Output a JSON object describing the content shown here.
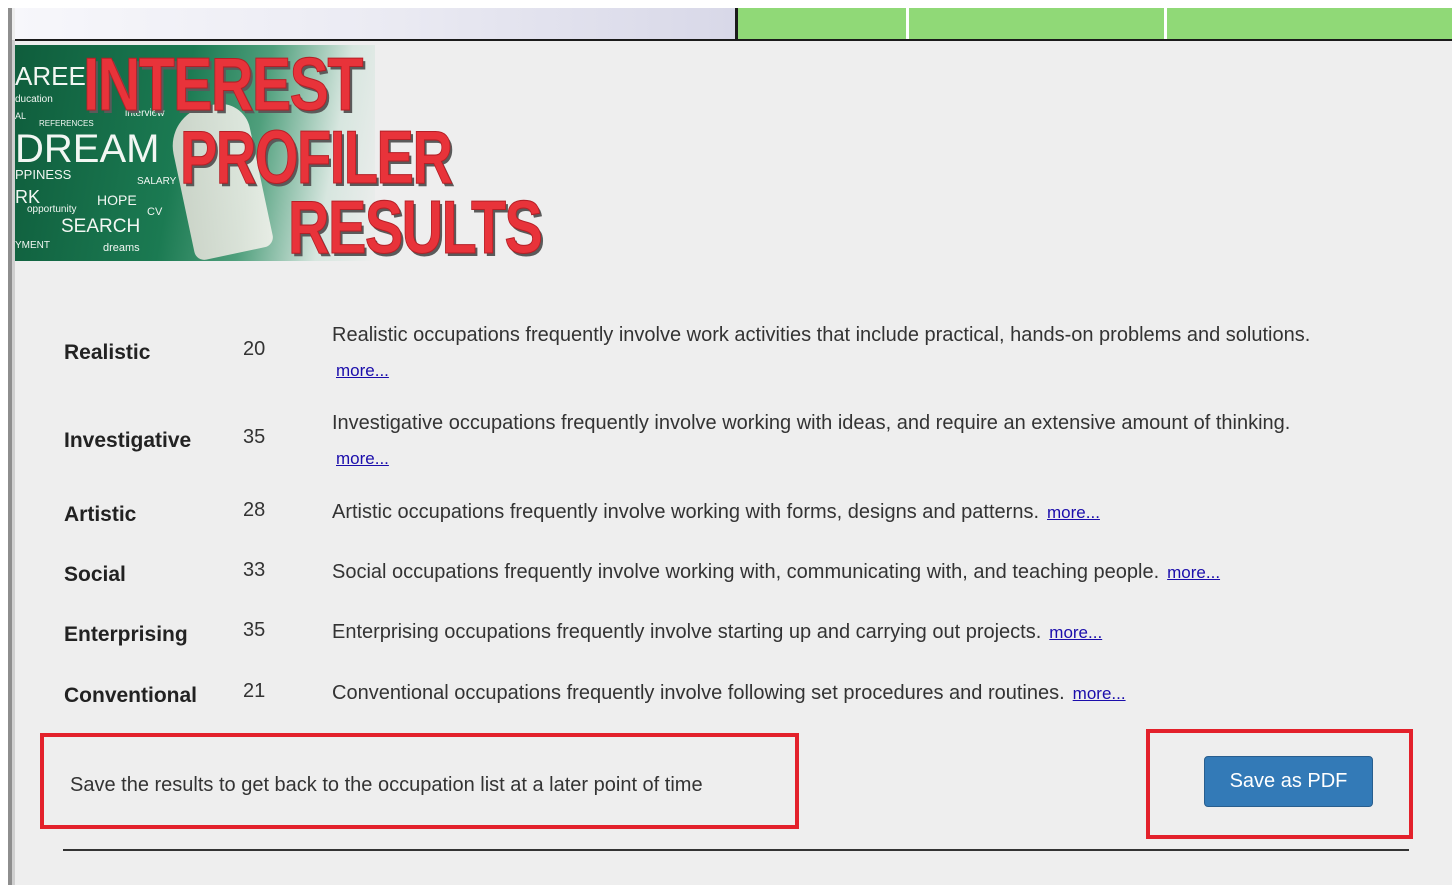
{
  "banner": {
    "title_line1": "INTEREST",
    "title_line2": "PROFILER",
    "title_line3": "RESULTS",
    "chalk_words": [
      "AREE",
      "DREAM",
      "PPINESS",
      "RK",
      "opportunity",
      "HOPE",
      "SALARY",
      "SEARCH",
      "CV",
      "dreams",
      "YMENT",
      "REFERENCES",
      "interview",
      "AL",
      "ducation"
    ]
  },
  "results": [
    {
      "name": "Realistic",
      "score": "20",
      "description": "Realistic occupations frequently involve work activities that include practical, hands-on problems and solutions.",
      "more": "more..."
    },
    {
      "name": "Investigative",
      "score": "35",
      "description": "Investigative occupations frequently involve working with ideas, and require an extensive amount of thinking.",
      "more": "more..."
    },
    {
      "name": "Artistic",
      "score": "28",
      "description": "Artistic occupations frequently involve working with forms, designs and patterns.",
      "more": "more..."
    },
    {
      "name": "Social",
      "score": "33",
      "description": "Social occupations frequently involve working with, communicating with, and teaching people.",
      "more": "more..."
    },
    {
      "name": "Enterprising",
      "score": "35",
      "description": "Enterprising occupations frequently involve starting up and carrying out projects.",
      "more": "more..."
    },
    {
      "name": "Conventional",
      "score": "21",
      "description": "Conventional occupations frequently involve following set procedures and routines.",
      "more": "more..."
    }
  ],
  "save": {
    "note": "Save the results to get back to the occupation list at a later point of time",
    "button_label": "Save as PDF"
  },
  "colors": {
    "accent_red": "#e3212b",
    "title_red": "#e8333a",
    "button_blue": "#337ab7",
    "nav_green": "#90d977",
    "link_blue": "#1a0dab"
  }
}
